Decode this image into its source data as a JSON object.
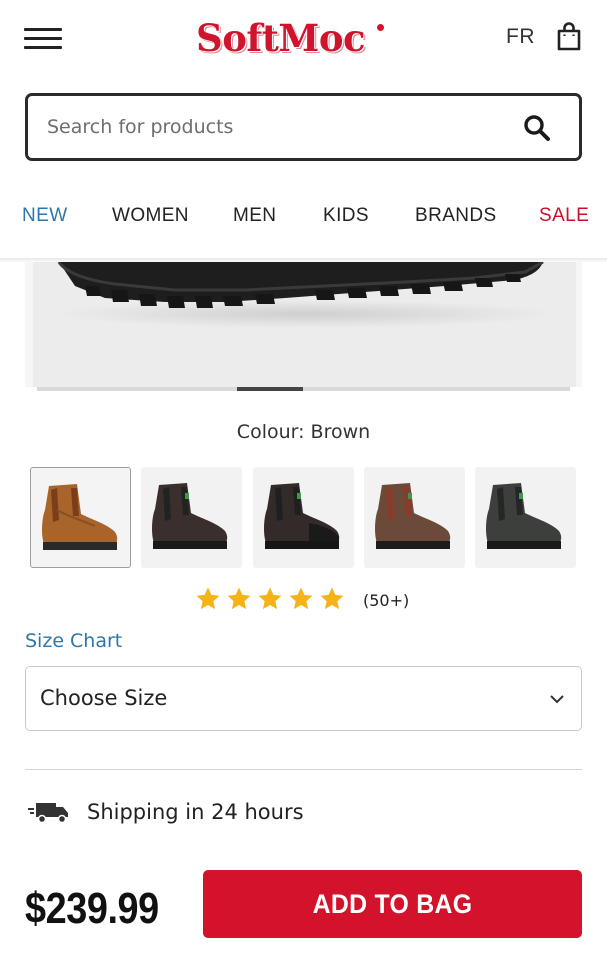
{
  "header": {
    "logo_text": "SoftMoc",
    "language_label": "FR",
    "menu_icon": "hamburger-menu-icon",
    "bag_icon": "shopping-bag-icon"
  },
  "search": {
    "placeholder": "Search for products",
    "value": "",
    "icon": "search-icon"
  },
  "nav": {
    "items": [
      {
        "label": "NEW",
        "color": "#2f77a8"
      },
      {
        "label": "WOMEN",
        "color": "#222222"
      },
      {
        "label": "MEN",
        "color": "#222222"
      },
      {
        "label": "KIDS",
        "color": "#222222"
      },
      {
        "label": "BRANDS",
        "color": "#222222"
      },
      {
        "label": "SALE",
        "color": "#c8102e"
      }
    ]
  },
  "product": {
    "colour_label": "Colour: Brown",
    "swatches": [
      {
        "colour": "brown",
        "selected": true
      },
      {
        "colour": "black",
        "selected": false
      },
      {
        "colour": "black",
        "selected": false
      },
      {
        "colour": "dark-brown",
        "selected": false
      },
      {
        "colour": "dark-grey",
        "selected": false
      }
    ],
    "rating": {
      "stars": 5,
      "max": 5,
      "review_count": "(50+)",
      "star_color": "#f5b318"
    },
    "size_chart_label": "Size Chart",
    "size_select": {
      "selected": "Choose Size"
    },
    "shipping_text": "Shipping in 24 hours",
    "price": "$239.99",
    "add_to_bag_label": "ADD TO BAG"
  },
  "colors": {
    "brand_red": "#d3122b",
    "link_blue": "#2f77a8"
  }
}
